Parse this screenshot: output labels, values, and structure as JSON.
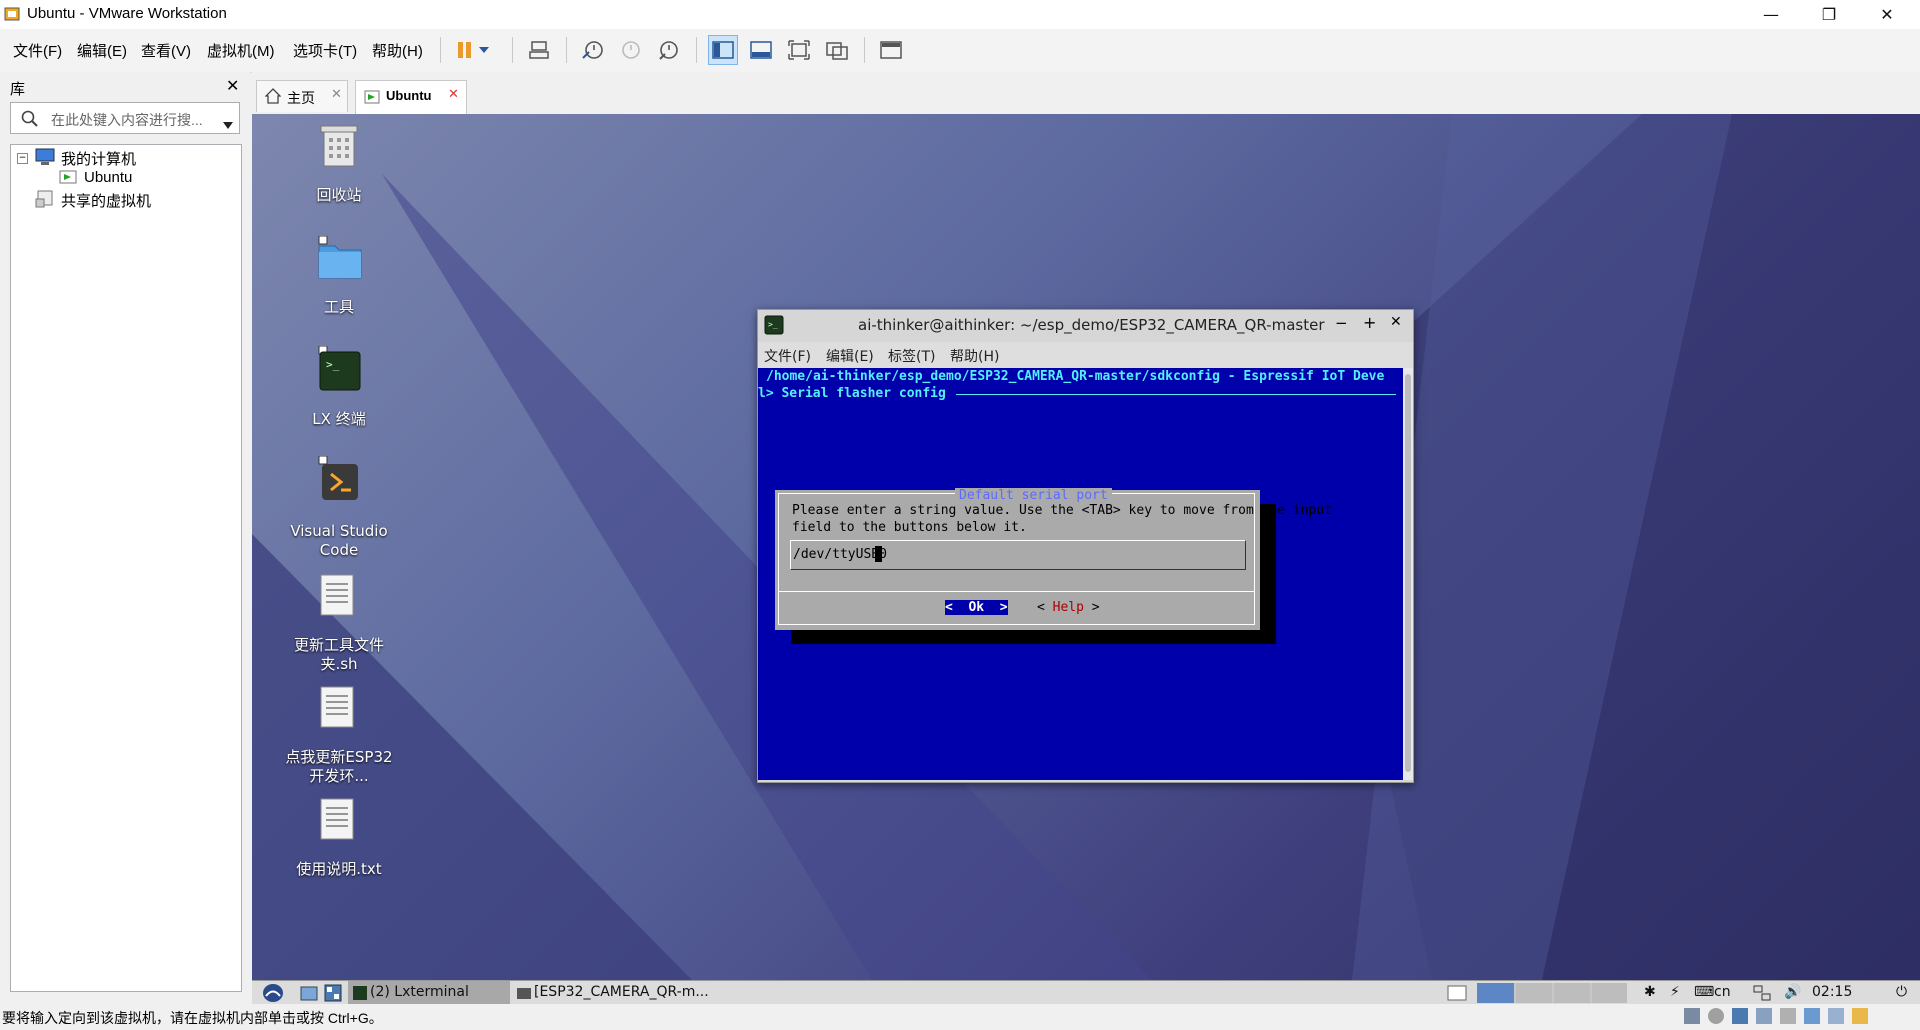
{
  "window": {
    "title": "Ubuntu - VMware Workstation"
  },
  "menu": {
    "items": [
      "文件(F)",
      "编辑(E)",
      "查看(V)",
      "虚拟机(M)",
      "选项卡(T)",
      "帮助(H)"
    ]
  },
  "library": {
    "title": "库",
    "search_placeholder": "在此处键入内容进行搜...",
    "tree": {
      "root": "我的计算机",
      "vm": "Ubuntu",
      "shared": "共享的虚拟机"
    }
  },
  "tabs": [
    {
      "label": "主页"
    },
    {
      "label": "Ubuntu"
    }
  ],
  "desktop": {
    "icons": [
      {
        "label": "回收站"
      },
      {
        "label": "工具"
      },
      {
        "label": "LX 终端"
      },
      {
        "label": "Visual Studio Code"
      },
      {
        "label": "更新工具文件夹.sh"
      },
      {
        "label": "点我更新ESP32开发环..."
      },
      {
        "label": "使用说明.txt"
      }
    ]
  },
  "terminal": {
    "title": "ai-thinker@aithinker: ~/esp_demo/ESP32_CAMERA_QR-master",
    "menu": [
      "文件(F)",
      "编辑(E)",
      "标签(T)",
      "帮助(H)"
    ],
    "header_line": "/home/ai-thinker/esp_demo/ESP32_CAMERA_QR-master/sdkconfig - Espressif IoT Deve",
    "breadcrumb": "l> Serial flasher config",
    "dialog": {
      "title": "Default serial port",
      "message_line1": "Please enter a string value. Use the <TAB> key to move from the input",
      "message_line2": "field to the buttons below it.",
      "input_value": "/dev/ttyUSB0",
      "ok_label": "<  Ok  >",
      "help_prefix": "< ",
      "help_label": "Help",
      "help_suffix": " >"
    }
  },
  "taskbar": {
    "tasks": [
      "(2) Lxterminal",
      "[ESP32_CAMERA_QR-m..."
    ],
    "lang": "cn",
    "clock": "02:15"
  },
  "statusbar": {
    "text": "要将输入定向到该虚拟机，请在虚拟机内部单击或按 Ctrl+G。"
  }
}
